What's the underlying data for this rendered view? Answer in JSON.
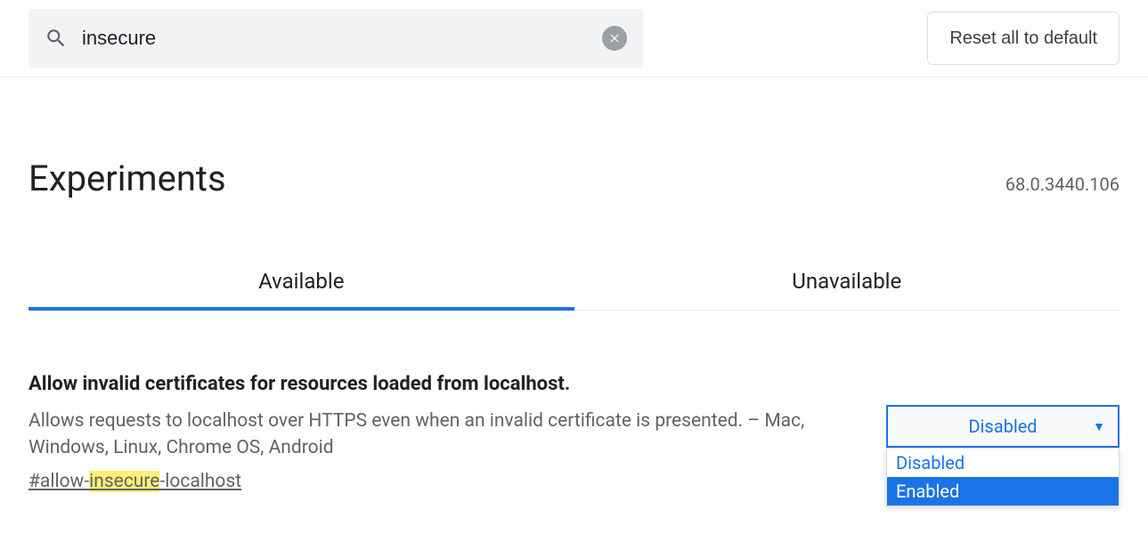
{
  "search": {
    "value": "insecure"
  },
  "reset_label": "Reset all to default",
  "page_title": "Experiments",
  "version": "68.0.3440.106",
  "tabs": {
    "available": "Available",
    "unavailable": "Unavailable"
  },
  "flag": {
    "title": "Allow invalid certificates for resources loaded from localhost.",
    "description": "Allows requests to localhost over HTTPS even when an invalid certificate is presented. – Mac, Windows, Linux, Chrome OS, Android",
    "id_prefix": "#allow-",
    "id_highlight": "insecure",
    "id_suffix": "-localhost",
    "select": {
      "current": "Disabled",
      "options": [
        "Disabled",
        "Enabled"
      ],
      "highlighted_index": 1
    }
  }
}
